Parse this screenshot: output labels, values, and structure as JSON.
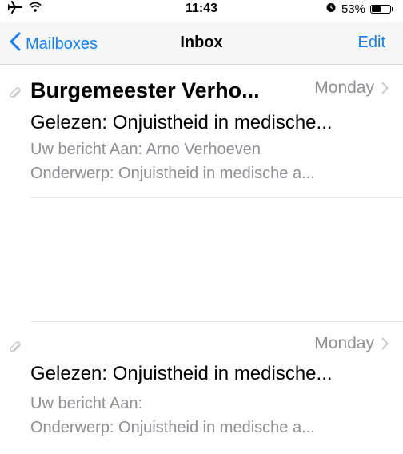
{
  "status_bar": {
    "time": "11:43",
    "battery_percent": "53%",
    "battery_level": 0.53
  },
  "nav": {
    "back_label": "Mailboxes",
    "title": "Inbox",
    "edit_label": "Edit"
  },
  "messages": [
    {
      "sender": "Burgemeester Verho...",
      "date": "Monday",
      "subject": "Gelezen: Onjuistheid in medische...",
      "preview_line1": "Uw bericht Aan: Arno Verhoeven",
      "preview_line2": "Onderwerp: Onjuistheid in medische a...",
      "has_attachment": true
    },
    {
      "sender": "",
      "date": "Monday",
      "subject": "Gelezen: Onjuistheid in medische...",
      "preview_line1": "Uw bericht Aan:",
      "preview_line2": "Onderwerp: Onjuistheid in medische a...",
      "has_attachment": true
    }
  ],
  "colors": {
    "accent": "#157efb",
    "secondary_text": "#8e8e93",
    "separator": "#e3e3e6"
  }
}
